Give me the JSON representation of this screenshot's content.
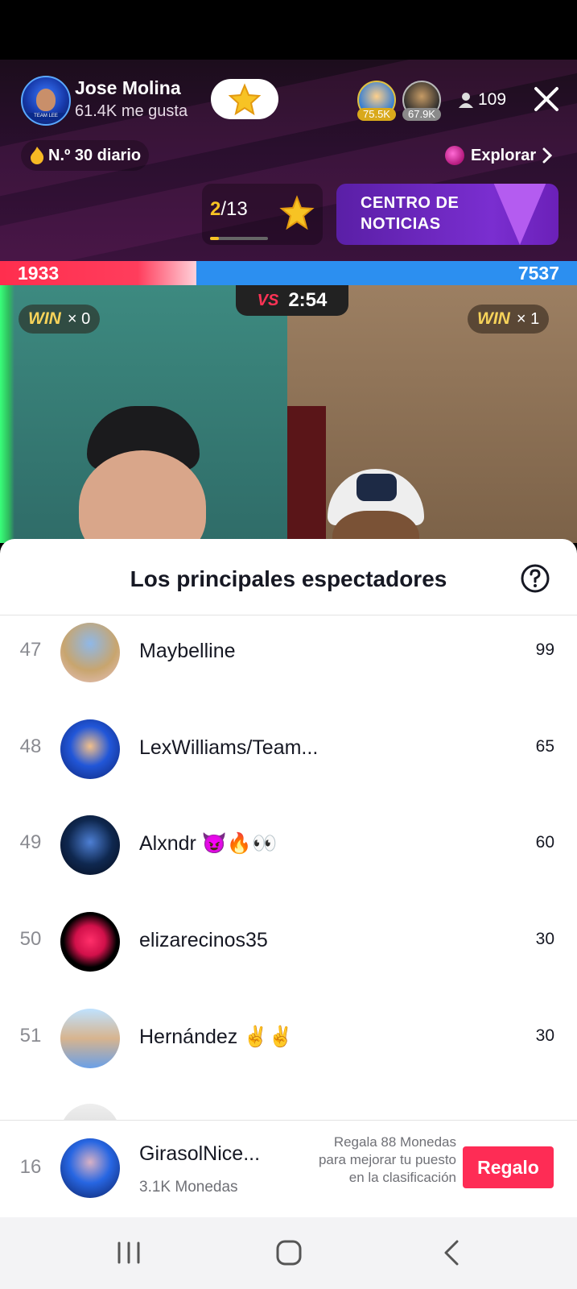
{
  "host": {
    "name": "Jose Molina",
    "likes": "61.4K me gusta",
    "avatar_label": "TEAM LEE"
  },
  "top_viewers": [
    {
      "score": "75.5K"
    },
    {
      "score": "67.9K"
    }
  ],
  "viewer_count": "109",
  "rank": {
    "text": "N.º 30 diario"
  },
  "explore": {
    "label": "Explorar"
  },
  "progress": {
    "current": "2",
    "total": "/13",
    "fraction": 0.15
  },
  "news": {
    "line1": "CENTRO DE",
    "line2": "NOTICIAS"
  },
  "battle": {
    "left_score": "1933",
    "right_score": "7537",
    "timer": "2:54",
    "vs_label": "VS",
    "left_win": "× 0",
    "right_win": "× 1",
    "win_label": "WIN",
    "left_share": 0.34
  },
  "sheet": {
    "title": "Los principales espectadores",
    "rows": [
      {
        "rank": "47",
        "name": "Maybelline",
        "score": "99"
      },
      {
        "rank": "48",
        "name": "LexWilliams/Team...",
        "score": "65"
      },
      {
        "rank": "49",
        "name": "Alxndr 😈🔥👀",
        "score": "60"
      },
      {
        "rank": "50",
        "name": "elizarecinos35",
        "score": "30"
      },
      {
        "rank": "51",
        "name": "Hernández ✌✌",
        "score": "30"
      },
      {
        "rank": "",
        "name": "",
        "score": ""
      }
    ]
  },
  "me": {
    "rank": "16",
    "name": "GirasolNice...",
    "coins": "3.1K Monedas",
    "hint": "Regala 88 Monedas para mejorar tu puesto en la clasificación",
    "gift_label": "Regalo"
  },
  "icons": {
    "close": "close-icon",
    "person": "person-icon",
    "flame": "flame-icon",
    "star": "star-icon",
    "help": "help-icon",
    "chevron": "chevron-right-icon",
    "nav": [
      "recents-icon",
      "home-icon",
      "back-icon"
    ]
  },
  "colors": {
    "accent": "#fe2c55",
    "battle_red": "#ff2e4e",
    "battle_blue": "#2c8ff0",
    "gold": "#f7c324"
  }
}
